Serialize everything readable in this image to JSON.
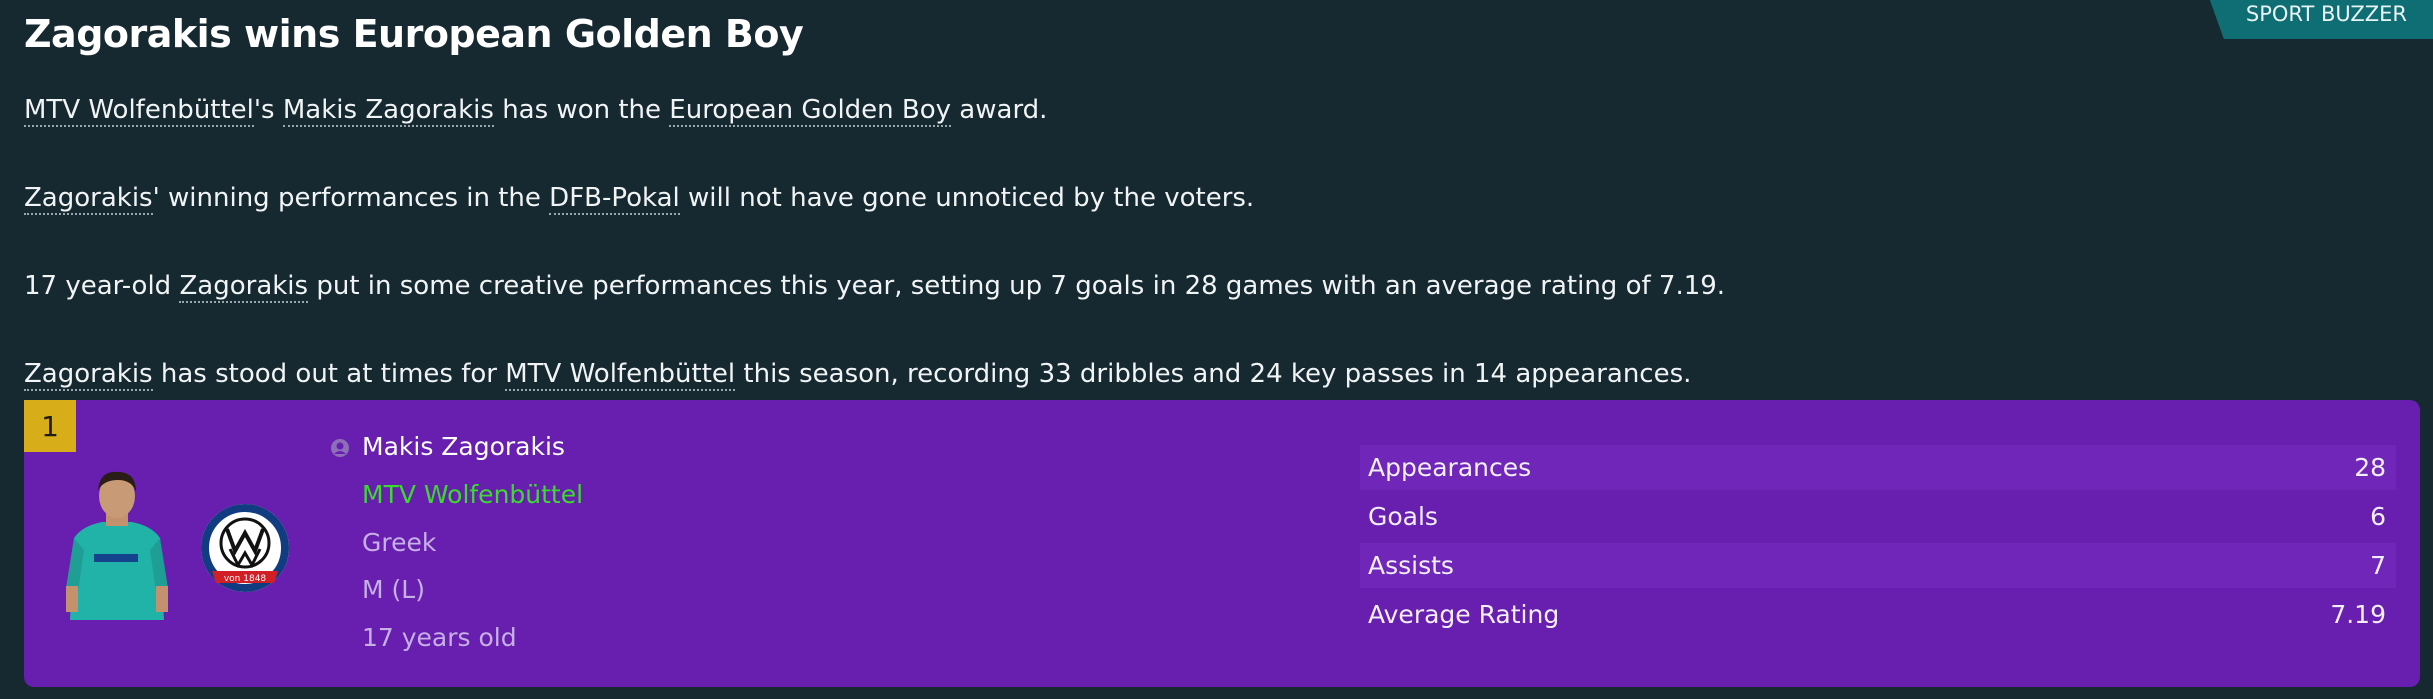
{
  "source": "SPORT BUZZER",
  "headline": "Zagorakis wins European Golden Boy",
  "paragraphs": {
    "p1": {
      "club": "MTV Wolfenbüttel",
      "apos": "'s ",
      "player": "Makis Zagorakis",
      "t1": " has won the ",
      "award": "European Golden Boy",
      "t2": " award."
    },
    "p2": {
      "player": "Zagorakis",
      "t1": "' winning performances in the ",
      "competition": "DFB-Pokal",
      "t2": " will not have gone unnoticed by the voters."
    },
    "p3": {
      "t0": "17 year-old ",
      "player": "Zagorakis",
      "t1": " put in some creative performances this year, setting up 7 goals in 28 games with an average rating of 7.19."
    },
    "p4": {
      "player": "Zagorakis",
      "t1": " has stood out at times for ",
      "club": "MTV Wolfenbüttel",
      "t2": " this season, recording 33 dribbles and 24 key passes in 14 appearances."
    }
  },
  "card": {
    "rank": "1",
    "name": "Makis Zagorakis",
    "club": "MTV Wolfenbüttel",
    "nationality": "Greek",
    "position": "M (L)",
    "age": "17 years old",
    "badge_year": "von 1848",
    "stats": [
      {
        "label": "Appearances",
        "value": "28"
      },
      {
        "label": "Goals",
        "value": "6"
      },
      {
        "label": "Assists",
        "value": "7"
      },
      {
        "label": "Average Rating",
        "value": "7.19"
      }
    ]
  },
  "colors": {
    "background": "#162830",
    "card": "#681eae",
    "rank": "#d8ad1a",
    "club_link": "#3adb2e",
    "source_tag": "#0f6e74"
  }
}
